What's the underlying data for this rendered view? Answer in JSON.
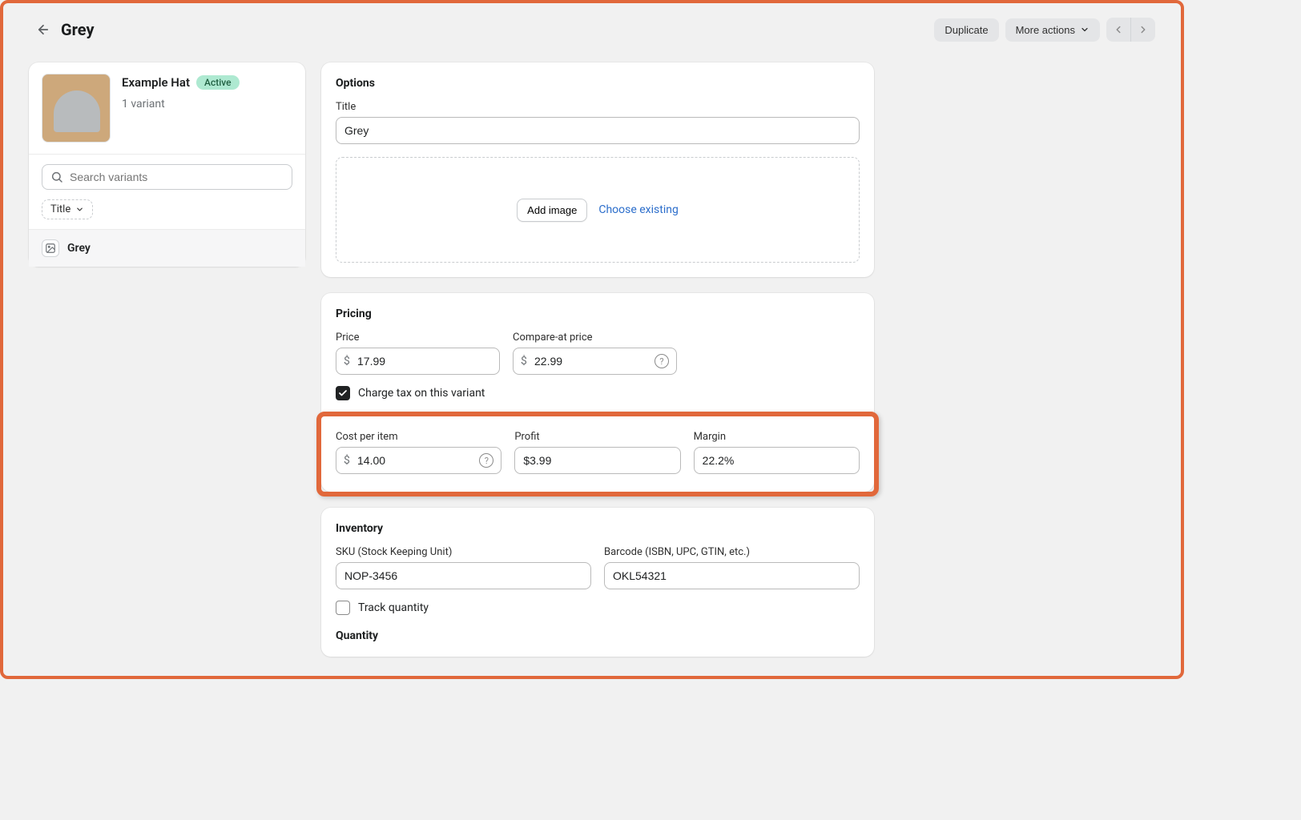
{
  "page": {
    "title": "Grey",
    "duplicate_label": "Duplicate",
    "more_actions_label": "More actions"
  },
  "product": {
    "name": "Example Hat",
    "status": "Active",
    "variant_count": "1 variant"
  },
  "sidebar": {
    "search_placeholder": "Search variants",
    "filter_label": "Title",
    "variant_item_label": "Grey"
  },
  "options": {
    "heading": "Options",
    "title_label": "Title",
    "title_value": "Grey",
    "add_image_label": "Add image",
    "choose_existing_label": "Choose existing"
  },
  "pricing": {
    "heading": "Pricing",
    "price_label": "Price",
    "price_value": "17.99",
    "compare_label": "Compare-at price",
    "compare_value": "22.99",
    "currency": "$",
    "charge_tax_label": "Charge tax on this variant",
    "cost_label": "Cost per item",
    "cost_value": "14.00",
    "profit_label": "Profit",
    "profit_value": "$3.99",
    "margin_label": "Margin",
    "margin_value": "22.2%"
  },
  "inventory": {
    "heading": "Inventory",
    "sku_label": "SKU (Stock Keeping Unit)",
    "sku_value": "NOP-3456",
    "barcode_label": "Barcode (ISBN, UPC, GTIN, etc.)",
    "barcode_value": "OKL54321",
    "track_label": "Track quantity",
    "quantity_label": "Quantity"
  }
}
